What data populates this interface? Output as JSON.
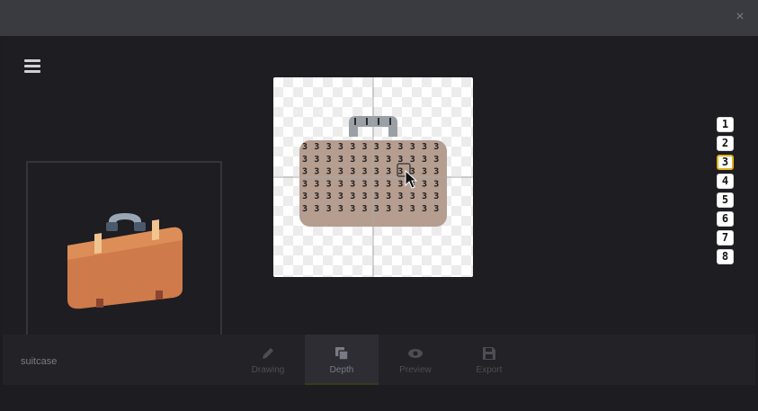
{
  "window": {
    "close_glyph": "×"
  },
  "menu": {
    "icon": "hamburger-icon"
  },
  "preview": {
    "icon": "suitcase-icon"
  },
  "editor": {
    "cell_glyph": "3"
  },
  "layers": {
    "items": [
      "1",
      "2",
      "3",
      "4",
      "5",
      "6",
      "7",
      "8"
    ],
    "active": "3",
    "accent": "#e0b21c"
  },
  "bottombar": {
    "filename": "suitcase",
    "tabs": [
      {
        "label": "Drawing",
        "icon": "pencil-icon"
      },
      {
        "label": "Depth",
        "icon": "layers-icon",
        "active": true
      },
      {
        "label": "Preview",
        "icon": "eye-icon"
      },
      {
        "label": "Export",
        "icon": "save-icon"
      }
    ]
  }
}
